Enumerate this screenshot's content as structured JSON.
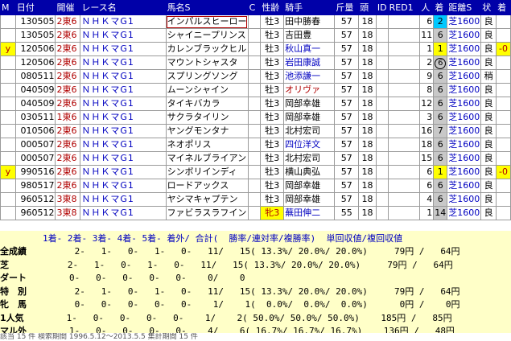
{
  "header": {
    "m": "M",
    "date": "日付",
    "kaisai": "開催",
    "race": "レース名",
    "horse": "馬名S",
    "c": "C",
    "sexage": "性齢",
    "jockey": "騎手",
    "weight": "斤量",
    "heads": "頭",
    "id": "ID",
    "red1": "RED1",
    "pop": "人",
    "rank": "着",
    "dist": "距離S",
    "cond": "状",
    "time": "着"
  },
  "rows": [
    {
      "date": "130505",
      "kaisai": "2東6",
      "race": "ＮＨＫマG1",
      "horse": "インパルスヒーロー",
      "sexage": "牡3",
      "jockey": "田中勝春",
      "jc": "#000000",
      "wt": "57",
      "heads": "18",
      "pop": "6",
      "rank": "2",
      "rankType": "hl",
      "dist": "芝1600",
      "cond": "良",
      "diff": "",
      "m": ""
    },
    {
      "date": "130505",
      "kaisai": "2東6",
      "race": "ＮＨＫマG1",
      "horse": "シャイニープリンス",
      "sexage": "牡3",
      "jockey": "吉田豊",
      "jc": "#000000",
      "wt": "57",
      "heads": "18",
      "pop": "11",
      "rank": "6",
      "rankType": "",
      "dist": "芝1600",
      "cond": "良",
      "diff": "",
      "m": ""
    },
    {
      "date": "120506",
      "kaisai": "2東6",
      "race": "ＮＨＫマG1",
      "horse": "カレンブラックヒル",
      "sexage": "牡3",
      "jockey": "秋山真一",
      "jc": "#0000c0",
      "wt": "57",
      "heads": "18",
      "pop": "1",
      "rank": "1",
      "rankType": "win",
      "dist": "芝1600",
      "cond": "良",
      "diff": "-0",
      "m": "y"
    },
    {
      "date": "120506",
      "kaisai": "2東6",
      "race": "ＮＨＫマG1",
      "horse": "マウントシャスタ",
      "sexage": "牡3",
      "jockey": "岩田康誠",
      "jc": "#0000c0",
      "wt": "57",
      "heads": "18",
      "pop": "2",
      "rank": "6",
      "rankType": "circ",
      "dist": "芝1600",
      "cond": "良",
      "diff": "",
      "m": ""
    },
    {
      "date": "080511",
      "kaisai": "2東6",
      "race": "ＮＨＫマG1",
      "horse": "スプリングソング",
      "sexage": "牡3",
      "jockey": "池添謙一",
      "jc": "#0000c0",
      "wt": "57",
      "heads": "18",
      "pop": "9",
      "rank": "6",
      "rankType": "",
      "dist": "芝1600",
      "cond": "稍",
      "diff": "",
      "m": ""
    },
    {
      "date": "040509",
      "kaisai": "2東6",
      "race": "ＮＨＫマG1",
      "horse": "ムーンシャイン",
      "sexage": "牡3",
      "jockey": "オリヴァ",
      "jc": "#b00000",
      "wt": "57",
      "heads": "18",
      "pop": "8",
      "rank": "6",
      "rankType": "",
      "dist": "芝1600",
      "cond": "良",
      "diff": "",
      "m": ""
    },
    {
      "date": "040509",
      "kaisai": "2東6",
      "race": "ＮＨＫマG1",
      "horse": "タイキバカラ",
      "sexage": "牡3",
      "jockey": "岡部幸雄",
      "jc": "#000000",
      "wt": "57",
      "heads": "18",
      "pop": "12",
      "rank": "6",
      "rankType": "",
      "dist": "芝1600",
      "cond": "良",
      "diff": "",
      "m": ""
    },
    {
      "date": "030511",
      "kaisai": "1東6",
      "race": "ＮＨＫマG1",
      "horse": "サクラタイリン",
      "sexage": "牡3",
      "jockey": "岡部幸雄",
      "jc": "#000000",
      "wt": "57",
      "heads": "18",
      "pop": "3",
      "rank": "6",
      "rankType": "",
      "dist": "芝1600",
      "cond": "良",
      "diff": "",
      "m": ""
    },
    {
      "date": "010506",
      "kaisai": "2東6",
      "race": "ＮＨＫマG1",
      "horse": "ヤングモンタナ",
      "sexage": "牡3",
      "jockey": "北村宏司",
      "jc": "#000000",
      "wt": "57",
      "heads": "18",
      "pop": "16",
      "rank": "7",
      "rankType": "",
      "dist": "芝1600",
      "cond": "良",
      "diff": "",
      "m": ""
    },
    {
      "date": "000507",
      "kaisai": "2東6",
      "race": "ＮＨＫマG1",
      "horse": "ネオポリス",
      "sexage": "牡3",
      "jockey": "四位洋文",
      "jc": "#0000c0",
      "wt": "57",
      "heads": "18",
      "pop": "18",
      "rank": "6",
      "rankType": "",
      "dist": "芝1600",
      "cond": "良",
      "diff": "",
      "m": ""
    },
    {
      "date": "000507",
      "kaisai": "2東6",
      "race": "ＮＨＫマG1",
      "horse": "マイネルブライアン",
      "sexage": "牡3",
      "jockey": "北村宏司",
      "jc": "#000000",
      "wt": "57",
      "heads": "18",
      "pop": "15",
      "rank": "6",
      "rankType": "",
      "dist": "芝1600",
      "cond": "良",
      "diff": "",
      "m": ""
    },
    {
      "date": "990516",
      "kaisai": "2東6",
      "race": "ＮＨＫマG1",
      "horse": "シンボリインディ",
      "sexage": "牡3",
      "jockey": "横山典弘",
      "jc": "#000000",
      "wt": "57",
      "heads": "18",
      "pop": "6",
      "rank": "1",
      "rankType": "win",
      "dist": "芝1600",
      "cond": "良",
      "diff": "-0",
      "m": "y"
    },
    {
      "date": "980517",
      "kaisai": "2東6",
      "race": "ＮＨＫマG1",
      "horse": "ロードアックス",
      "sexage": "牡3",
      "jockey": "岡部幸雄",
      "jc": "#000000",
      "wt": "57",
      "heads": "18",
      "pop": "6",
      "rank": "6",
      "rankType": "",
      "dist": "芝1600",
      "cond": "良",
      "diff": "",
      "m": ""
    },
    {
      "date": "960512",
      "kaisai": "3東8",
      "race": "ＮＨＫマG1",
      "horse": "ヤシマキャプテン",
      "sexage": "牡3",
      "jockey": "岡部幸雄",
      "jc": "#000000",
      "wt": "57",
      "heads": "18",
      "pop": "4",
      "rank": "6",
      "rankType": "",
      "dist": "芝1600",
      "cond": "良",
      "diff": "",
      "m": ""
    },
    {
      "date": "960512",
      "kaisai": "3東8",
      "race": "ＮＨＫマG1",
      "horse": "ファビラスラフイン",
      "sexage": "牝3",
      "sexRed": true,
      "jockey": "蕪田伸二",
      "jc": "#0000c0",
      "wt": "55",
      "heads": "18",
      "pop": "1",
      "rank": "14",
      "rankType": "",
      "dist": "芝1600",
      "cond": "良",
      "diff": "",
      "m": ""
    }
  ],
  "summary": {
    "header": "        1着- 2着- 3着- 4着- 5着- 着外/ 合計(  勝率/連対率/複勝率)  単回収値/複回収値",
    "rows": [
      {
        "label": "全成績",
        "text": "         2-   1-   0-   1-   0-   11/   15( 13.3%/ 20.0%/ 20.0%)     79円 /   64円"
      },
      {
        "label": "芝",
        "text": "           2-   1-   0-   1-   0-   11/   15( 13.3%/ 20.0%/ 20.0%)     79円 /   64円"
      },
      {
        "label": "ダート",
        "text": "        0-   0-   0-   0-   0-    0/    0"
      },
      {
        "label": "特　別",
        "text": "         2-   1-   0-   1-   0-   11/   15( 13.3%/ 20.0%/ 20.0%)     79円 /   64円"
      },
      {
        "label": "牝　馬",
        "text": "         0-   0-   0-   0-   0-    1/    1(  0.0%/  0.0%/  0.0%)      0円 /    0円"
      },
      {
        "label": "1人気",
        "text": "        1-   0-   0-   0-   0-    1/    2( 50.0%/ 50.0%/ 50.0%)    185円 /   85円"
      },
      {
        "label": "マル外",
        "text": "        1-   0-   0-   0-   0-    4/    6( 16.7%/ 16.7%/ 16.7%)    136円 /   48円"
      }
    ]
  },
  "footer": "該当 15 件   検索期間 1996.5.12～2013.5.5                                        集計期間 15 件"
}
